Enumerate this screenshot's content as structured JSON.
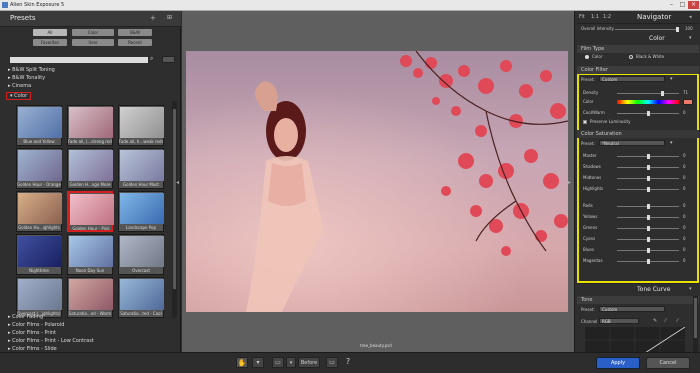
{
  "window": {
    "title": "Alien Skin Exposure 5"
  },
  "presets": {
    "header": "Presets",
    "filter_buttons_row1": [
      "All",
      "Color",
      "B&W"
    ],
    "filter_buttons_row2": [
      "Favorites",
      "User",
      "Recent"
    ],
    "tree_top": [
      "B&W Split Toning",
      "B&W Tonality",
      "Cinema",
      "Color"
    ],
    "thumbnails": [
      [
        "Blue and Yellow",
        "Fade all, (...strong reds",
        "Fade all, h...weak reds"
      ],
      [
        "Golden Hour - Orange",
        "Golden H...nge More",
        "Golden Hour Most"
      ],
      [
        "Golden Ho...ighlights",
        "Golden Hour - Pink",
        "Landscape Pop"
      ],
      [
        "Nighttime",
        "Noon Day Sun",
        "Overcast"
      ],
      [
        "Overcast (...ighlights)",
        "Saturatio...ed - Warm",
        "Saturatio...ted - Cool"
      ]
    ],
    "tree_bottom": [
      "Color Fading",
      "Color Films - Polaroid",
      "Color Films - Print",
      "Color Films - Print - Low Contrast",
      "Color Films - Slide"
    ]
  },
  "canvas": {
    "filename": "tree_beauty.psd"
  },
  "toolbar": {
    "before": "Before"
  },
  "right": {
    "navigator": "Navigator",
    "overall_intensity_label": "Overall Intensity",
    "overall_intensity_value": "100",
    "tab": "Color",
    "film_type": {
      "title": "Film Type",
      "options": [
        "Color",
        "Black & White"
      ]
    },
    "color_filter": {
      "title": "Color Filter",
      "preset_label": "Preset:",
      "preset_value": "Custom",
      "density_label": "Density",
      "density_value": "71",
      "color_label": "Color",
      "coolwarm_label": "Cool/Warm",
      "coolwarm_value": "0",
      "preserve": "Preserve Luminosity",
      "color_swatch": "#ee7a6a"
    },
    "color_saturation": {
      "title": "Color Saturation",
      "preset_label": "Preset:",
      "preset_value": "*Neutral",
      "rows": [
        {
          "l": "Master",
          "v": "0"
        },
        {
          "l": "Shadows",
          "v": "0"
        },
        {
          "l": "Midtones",
          "v": "0"
        },
        {
          "l": "Highlights",
          "v": "0"
        },
        {
          "l": "Reds",
          "v": "0"
        },
        {
          "l": "Yellows",
          "v": "0"
        },
        {
          "l": "Greens",
          "v": "0"
        },
        {
          "l": "Cyans",
          "v": "0"
        },
        {
          "l": "Blues",
          "v": "0"
        },
        {
          "l": "Magentas",
          "v": "0"
        }
      ]
    },
    "tone_curve": "Tone Curve",
    "tone": {
      "title": "Tone",
      "preset_label": "Preset:",
      "preset_value": "Custom",
      "channel_label": "Channel",
      "channel_value": "RGB"
    },
    "apply": "Apply",
    "cancel": "Cancel"
  }
}
